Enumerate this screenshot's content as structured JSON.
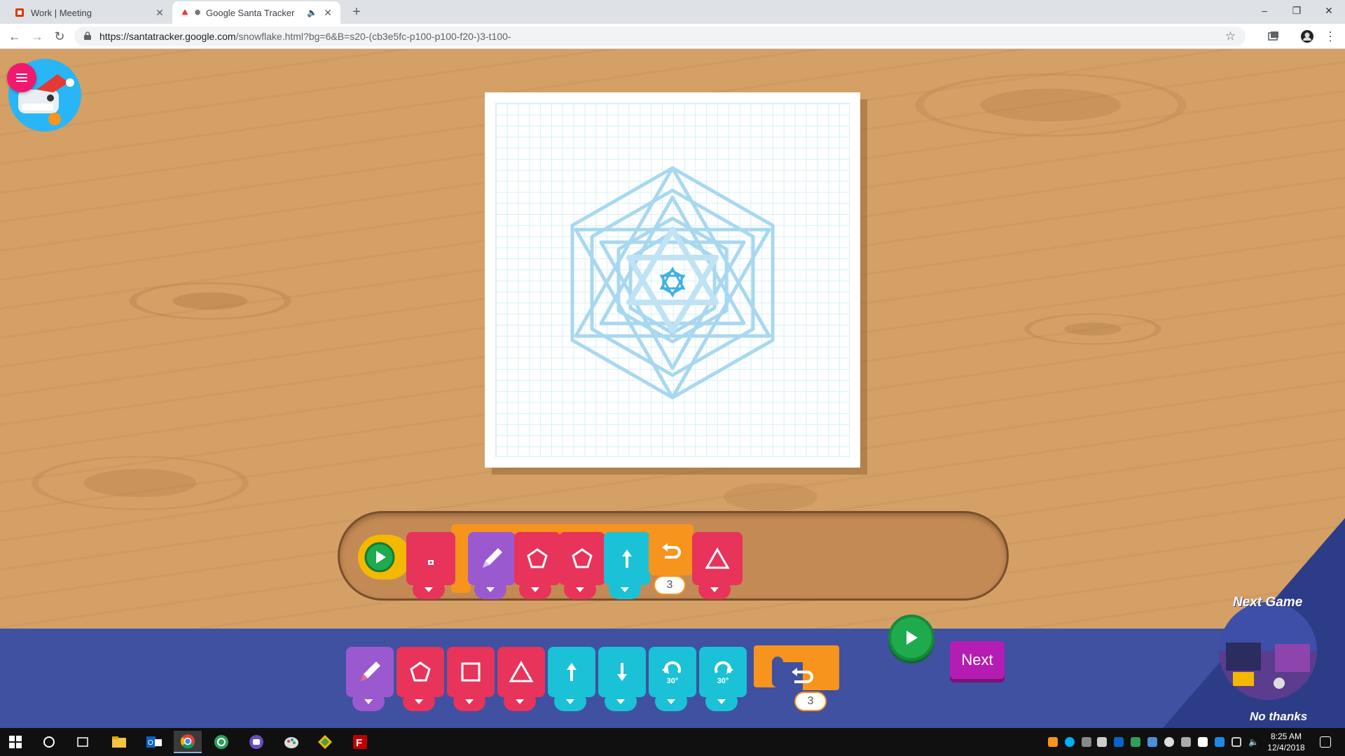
{
  "browser": {
    "tabs": [
      {
        "title": "Work | Meeting",
        "active": false
      },
      {
        "title": "Google Santa Tracker",
        "active": true
      }
    ],
    "url_host": "https://santatracker.google.com",
    "url_path": "/snowflake.html?bg=6&B=s20-(cb3e5fc-p100-p100-f20-)3-t100-",
    "window_controls": [
      "–",
      "❐",
      "✕"
    ]
  },
  "game": {
    "program_blocks": [
      {
        "type": "start",
        "icon": "play-icon",
        "color": "#f5b800"
      },
      {
        "type": "stamp",
        "icon": "stamp-icon",
        "color": "#e8335a"
      },
      {
        "type": "pen",
        "icon": "pencil-icon",
        "color": "#9b59d0"
      },
      {
        "type": "pentagon",
        "icon": "pentagon-icon",
        "color": "#e8335a"
      },
      {
        "type": "pentagon",
        "icon": "pentagon-icon",
        "color": "#e8335a"
      },
      {
        "type": "forward",
        "icon": "arrow-up-icon",
        "color": "#1bc1d6"
      },
      {
        "type": "repeat",
        "icon": "repeat-icon",
        "color": "#f7941d",
        "count": "3"
      },
      {
        "type": "triangle",
        "icon": "triangle-icon",
        "color": "#e8335a"
      }
    ],
    "toolbox_blocks": [
      {
        "type": "pen",
        "icon": "pencil-icon",
        "color": "#9b59d0"
      },
      {
        "type": "pentagon",
        "icon": "pentagon-icon",
        "color": "#e8335a"
      },
      {
        "type": "square",
        "icon": "square-icon",
        "color": "#e8335a"
      },
      {
        "type": "triangle",
        "icon": "triangle-icon",
        "color": "#e8335a"
      },
      {
        "type": "forward",
        "icon": "arrow-up-icon",
        "color": "#1bc1d6"
      },
      {
        "type": "backward",
        "icon": "arrow-down-icon",
        "color": "#1bc1d6"
      },
      {
        "type": "turn-left",
        "icon": "rotate-left-icon",
        "color": "#1bc1d6",
        "label": "30°"
      },
      {
        "type": "turn-right",
        "icon": "rotate-right-icon",
        "color": "#1bc1d6",
        "label": "30°"
      },
      {
        "type": "repeat",
        "icon": "repeat-icon",
        "color": "#f7941d",
        "count": "3"
      }
    ],
    "next_label": "Next",
    "next_game_label": "Next Game",
    "no_thanks_label": "No thanks"
  },
  "taskbar": {
    "time": "8:25 AM",
    "date": "12/4/2018"
  },
  "colors": {
    "wood": "#d4a066",
    "toolbox": "#3f51a0",
    "pink": "#e8335a",
    "cyan": "#1bc1d6",
    "purple": "#9b59d0",
    "orange": "#f7941d",
    "green": "#1faa4e",
    "snowflake": "#a8d8f0"
  }
}
